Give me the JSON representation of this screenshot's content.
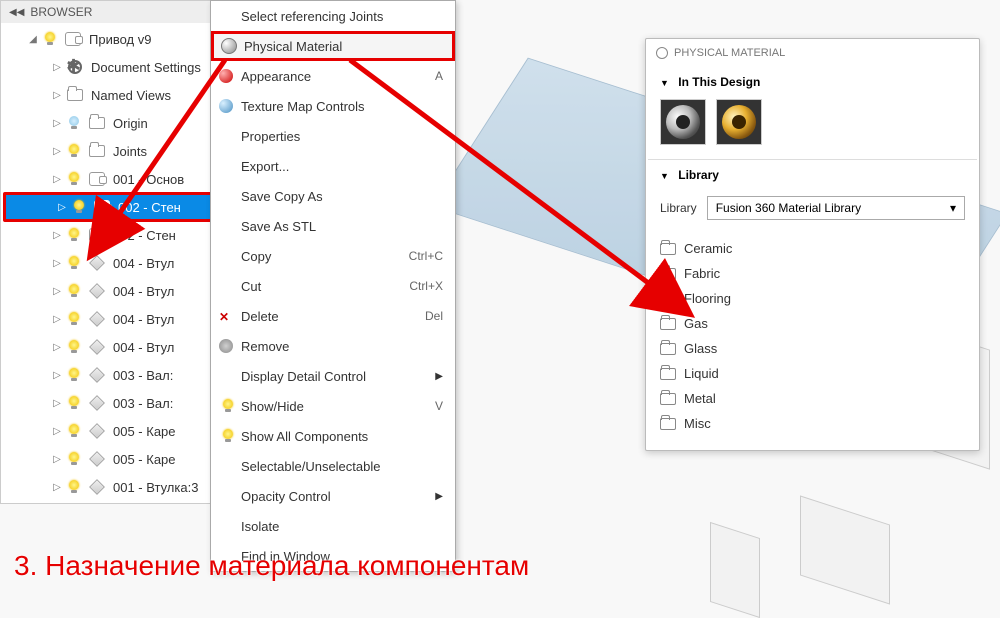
{
  "browser": {
    "title": "BROWSER",
    "root": "Привод v9",
    "doc_settings": "Document Settings",
    "named_views": "Named Views",
    "origin": "Origin",
    "joints": "Joints",
    "items": [
      "001 - Основ",
      "002 - Стен",
      "002 - Стен",
      "004 - Втул",
      "004 - Втул",
      "004 - Втул",
      "004 - Втул",
      "003 - Вал:",
      "003 - Вал:",
      "005 - Каре",
      "005 - Каре",
      "001 - Втулка:3"
    ]
  },
  "menu": {
    "select_referencing": "Select referencing Joints",
    "physical_material": "Physical Material",
    "appearance": "Appearance",
    "appearance_sc": "A",
    "texture_map": "Texture Map Controls",
    "properties": "Properties",
    "export": "Export...",
    "save_copy": "Save Copy As",
    "save_stl": "Save As STL",
    "copy": "Copy",
    "copy_sc": "Ctrl+C",
    "cut": "Cut",
    "cut_sc": "Ctrl+X",
    "delete": "Delete",
    "delete_sc": "Del",
    "remove": "Remove",
    "display_detail": "Display Detail Control",
    "showhide": "Show/Hide",
    "showhide_sc": "V",
    "show_all": "Show All Components",
    "selectable": "Selectable/Unselectable",
    "opacity": "Opacity Control",
    "isolate": "Isolate",
    "find_window": "Find in Window"
  },
  "material_panel": {
    "title": "PHYSICAL MATERIAL",
    "in_design": "In This Design",
    "library": "Library",
    "lib_label": "Library",
    "lib_select": "Fusion 360 Material Library",
    "folders": [
      "Ceramic",
      "Fabric",
      "Flooring",
      "Gas",
      "Glass",
      "Liquid",
      "Metal",
      "Misc"
    ]
  },
  "caption": "3. Назначение материала компонентам"
}
